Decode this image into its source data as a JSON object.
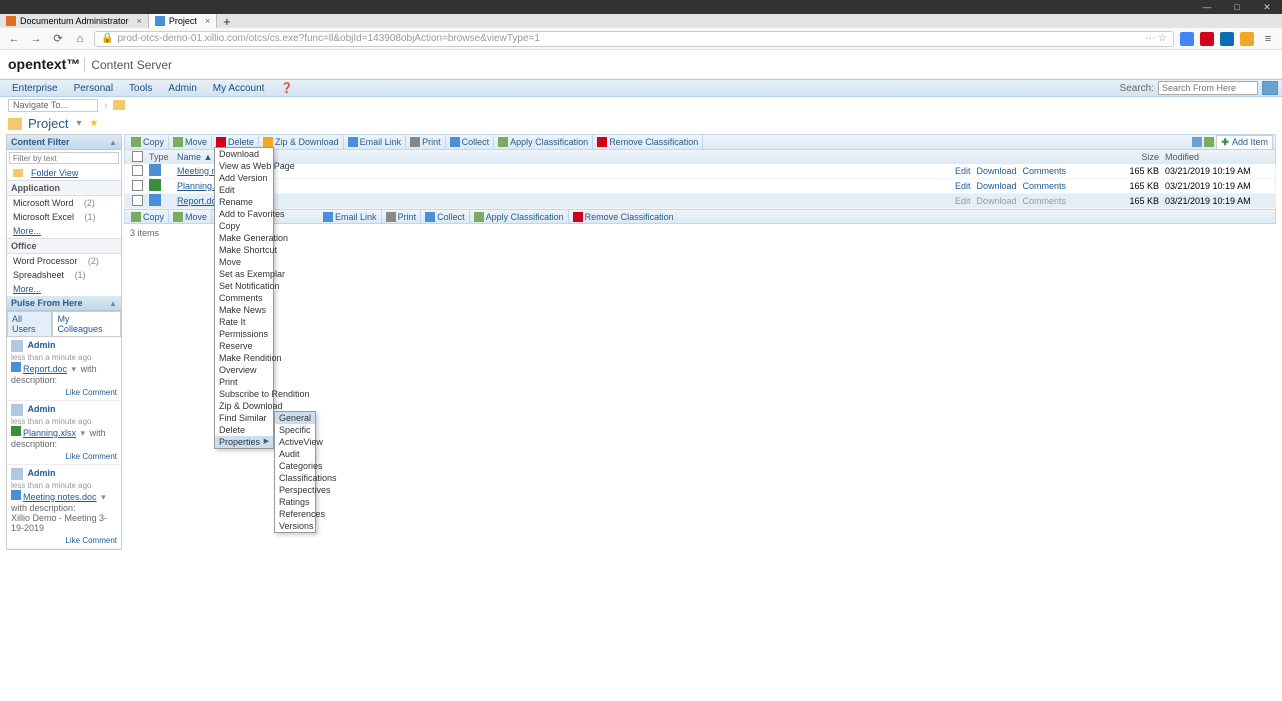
{
  "window": {
    "minimize": "—",
    "maximize": "□",
    "close": "✕"
  },
  "tabs": [
    {
      "label": "Documentum Administrator"
    },
    {
      "label": "Project"
    }
  ],
  "url": "prod-otcs-demo-01.xillio.com/otcs/cs.exe?func=ll&objId=143908objAction=browse&viewType=1",
  "app": {
    "logo": "opentext™",
    "product": "Content Server"
  },
  "nav": {
    "items": [
      "Enterprise",
      "Personal",
      "Tools",
      "Admin",
      "My Account"
    ],
    "search_label": "Search:",
    "search_placeholder": "Search From Here"
  },
  "breadcrumb": {
    "nav_to": "Navigate To...",
    "project": "Project"
  },
  "sidebar": {
    "content_filter": "Content Filter",
    "filter_placeholder": "Filter by text",
    "folder_view": "Folder View",
    "application": "Application",
    "app_items": [
      {
        "label": "Microsoft Word",
        "count": "(2)"
      },
      {
        "label": "Microsoft Excel",
        "count": "(1)"
      }
    ],
    "more": "More...",
    "office": "Office",
    "office_items": [
      {
        "label": "Word Processor",
        "count": "(2)"
      },
      {
        "label": "Spreadsheet",
        "count": "(1)"
      }
    ],
    "pulse": "Pulse From Here",
    "pulse_tabs": [
      "All Users",
      "My Colleagues"
    ],
    "pulse_entries": [
      {
        "user": "Admin",
        "time": "less than a minute ago",
        "doc": "Report.doc",
        "desc": "with description:"
      },
      {
        "user": "Admin",
        "time": "less than a minute ago",
        "doc": "Planning.xlsx",
        "desc": "with description:"
      },
      {
        "user": "Admin",
        "time": "less than a minute ago",
        "doc": "Meeting notes.doc",
        "desc": "with description:",
        "extra": "Xillio Demo - Meeting 3-19-2019"
      }
    ],
    "like": "Like",
    "comment": "Comment"
  },
  "toolbar": {
    "copy": "Copy",
    "move": "Move",
    "delete": "Delete",
    "zip": "Zip & Download",
    "email": "Email Link",
    "print": "Print",
    "collect": "Collect",
    "apply_class": "Apply Classification",
    "remove_class": "Remove Classification",
    "add_item": "Add Item"
  },
  "table": {
    "headers": {
      "type": "Type",
      "name": "Name ▲",
      "size": "Size",
      "modified": "Modified"
    },
    "rows": [
      {
        "name": "Meeting notes.doc",
        "type": "doc",
        "actions": [
          "Edit",
          "Download",
          "Comments"
        ],
        "size": "165 KB",
        "modified": "03/21/2019 10:19 AM"
      },
      {
        "name": "Planning.xlsx",
        "type": "xls",
        "actions": [
          "Edit",
          "Download",
          "Comments"
        ],
        "size": "165 KB",
        "modified": "03/21/2019 10:19 AM"
      },
      {
        "name": "Report.doc",
        "type": "doc",
        "actions": [
          "Edit",
          "Download",
          "Comments"
        ],
        "size": "165 KB",
        "modified": "03/21/2019 10:19 AM",
        "selected": true
      }
    ],
    "items_count": "3 items"
  },
  "context_menu": [
    "Download",
    "View as Web Page",
    "Add Version",
    "Edit",
    "Rename",
    "Add to Favorites",
    "Copy",
    "Make Generation",
    "Make Shortcut",
    "Move",
    "Set as Exemplar",
    "Set Notification",
    "Comments",
    "Make News",
    "Rate It",
    "Permissions",
    "Reserve",
    "Make Rendition",
    "Overview",
    "Print",
    "Subscribe to Rendition",
    "Zip & Download",
    "Find Similar",
    "Delete",
    "Properties"
  ],
  "sub_menu": [
    "General",
    "Specific",
    "ActiveView",
    "Audit",
    "Categories",
    "Classifications",
    "Perspectives",
    "Ratings",
    "References",
    "Versions"
  ]
}
